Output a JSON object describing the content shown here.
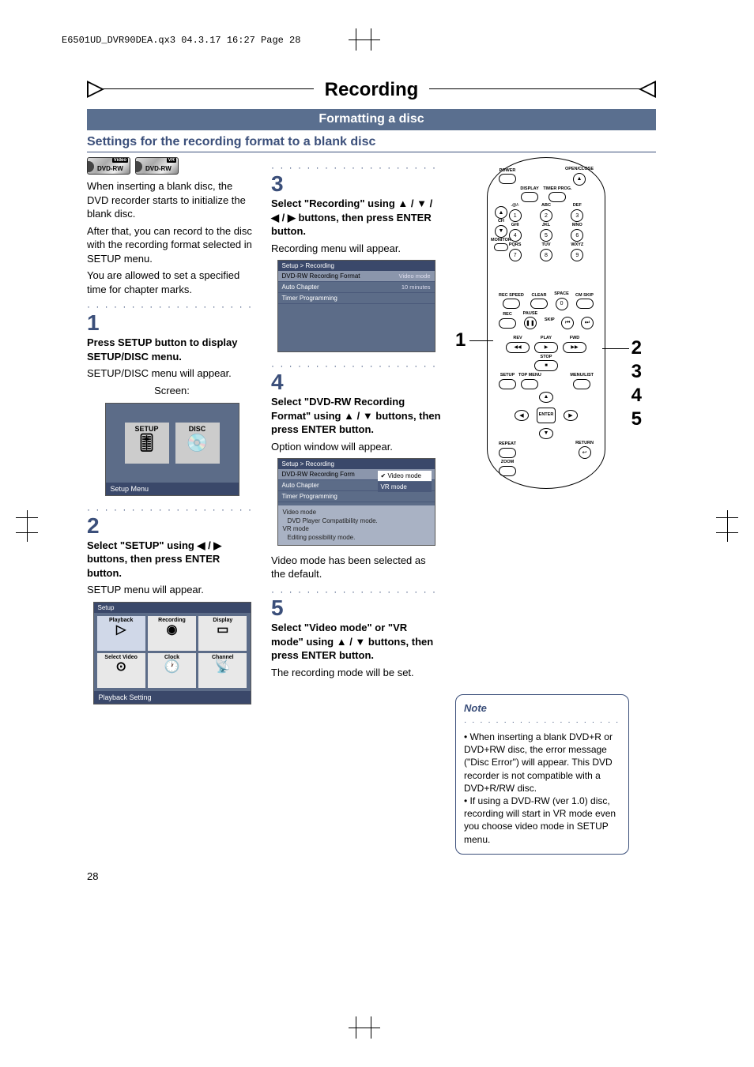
{
  "meta": {
    "filemark": "E6501UD_DVR90DEA.qx3  04.3.17  16:27  Page 28"
  },
  "title": "Recording",
  "subtitle": "Formatting a disc",
  "section": "Settings for the recording format to a blank disc",
  "badges": {
    "b1": {
      "main": "DVD-RW",
      "tag": "Video"
    },
    "b2": {
      "main": "DVD-RW",
      "tag": "VR"
    }
  },
  "intro": {
    "p1": "When inserting a blank disc, the DVD recorder starts to initialize the blank disc.",
    "p2": "After that, you can record to the disc with the recording format selected in SETUP menu.",
    "p3": "You are allowed to set a specified time for chapter marks."
  },
  "steps": {
    "s1": {
      "n": "1",
      "head": "Press SETUP button to display SETUP/DISC menu.",
      "body": "SETUP/DISC menu will appear.",
      "screen_label": "Screen:"
    },
    "s2": {
      "n": "2",
      "head": "Select \"SETUP\" using ◀ / ▶ buttons, then press ENTER button.",
      "body": "SETUP menu will appear."
    },
    "s3": {
      "n": "3",
      "head": "Select \"Recording\" using ▲ / ▼ / ◀ / ▶ buttons, then press ENTER button.",
      "body": "Recording menu will appear."
    },
    "s4": {
      "n": "4",
      "head": "Select \"DVD-RW Recording Format\" using ▲ / ▼ buttons, then press ENTER button.",
      "body": "Option window will appear.",
      "tail": "Video mode has been selected as the default."
    },
    "s5": {
      "n": "5",
      "head": "Select \"Video mode\" or \"VR mode\" using ▲ / ▼ buttons, then press ENTER button.",
      "body": "The recording mode will be set."
    }
  },
  "screen1": {
    "setup": "SETUP",
    "disc": "DISC",
    "caption": "Setup Menu"
  },
  "screen2": {
    "header": "Setup",
    "caption": "Playback Setting",
    "tiles": {
      "t1": "Playback",
      "t2": "Recording",
      "t3": "Display",
      "t4": "Select Video",
      "t5": "Clock",
      "t6": "Channel"
    }
  },
  "screen3": {
    "header": "Setup > Recording",
    "r1": {
      "k": "DVD-RW Recording Format",
      "v": "Video mode"
    },
    "r2": {
      "k": "Auto Chapter",
      "v": "10 minutes"
    },
    "r3": {
      "k": "Timer Programming",
      "v": ""
    }
  },
  "screen4": {
    "header": "Setup > Recording",
    "r1": {
      "k": "DVD-RW Recording Form"
    },
    "r2": {
      "k": "Auto Chapter"
    },
    "r3": {
      "k": "Timer Programming"
    },
    "opt1": "Video mode",
    "opt2": "VR mode",
    "desc1": "Video mode",
    "desc2": "DVD Player Compatibility mode.",
    "desc3": "VR mode",
    "desc4": "Editing possibility mode."
  },
  "remote": {
    "power": "POWER",
    "openclose": "OPEN/CLOSE",
    "display": "DISPLAY",
    "timerprog": "TIMER PROG.",
    "abc": "ABC",
    "def": "DEF",
    "at": ".@/:",
    "ch": "CH",
    "ghi": "GHI",
    "jkl": "JKL",
    "mno": "MNO",
    "monitor": "MONITOR",
    "pqrs": "PQRS",
    "tuv": "TUV",
    "wxyz": "WXYZ",
    "recspeed": "REC SPEED",
    "clear": "CLEAR",
    "space": "SPACE",
    "cmskip": "CM SKIP",
    "rec": "REC",
    "pause": "PAUSE",
    "skip": "SKIP",
    "rev": "REV",
    "play": "PLAY",
    "fwd": "FWD",
    "stop": "STOP",
    "setup": "SETUP",
    "topmenu": "TOP MENU",
    "menulist": "MENU/LIST",
    "repeat": "REPEAT",
    "enter": "ENTER",
    "return": "RETURN",
    "zoom": "ZOOM",
    "n1": "1",
    "n2": "2",
    "n3": "3",
    "n4": "4",
    "n5": "5",
    "n6": "6",
    "n7": "7",
    "n8": "8",
    "n9": "9",
    "n0": "0",
    "eject": "▲",
    "up": "▲",
    "down": "▼",
    "skipb": "⏮",
    "skipf": "⏭",
    "rew": "◀◀",
    "ff": "▶▶",
    "playicon": "▶",
    "stopicon": "■",
    "pauseicon": "❚❚",
    "arr_l": "◀",
    "arr_r": "▶",
    "arr_u": "▲",
    "arr_d": "▼",
    "entericon": "●",
    "ret": "↩"
  },
  "callouts": {
    "c1": "1",
    "c2": "2",
    "c3": "3",
    "c4": "4",
    "c5": "5"
  },
  "note": {
    "title": "Note",
    "li1": "When inserting a blank DVD+R or DVD+RW disc, the error message (\"Disc Error\") will appear. This DVD recorder is not compatible with a DVD+R/RW disc.",
    "li2": "If using a DVD-RW (ver 1.0) disc, recording will start in VR mode even you choose video mode in SETUP menu."
  },
  "page_number": "28"
}
